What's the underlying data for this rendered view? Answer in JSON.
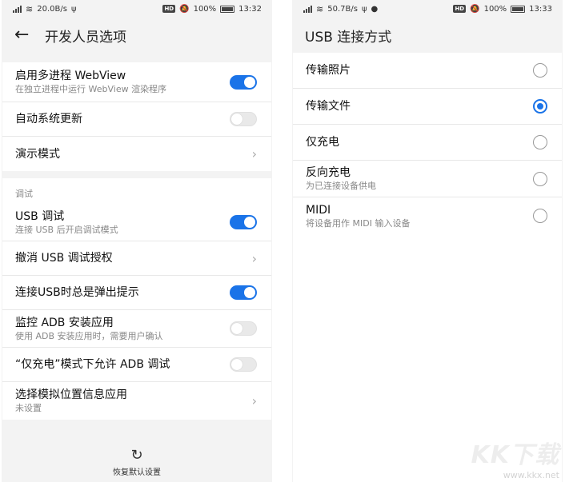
{
  "left": {
    "status": {
      "speed": "20.0B/s",
      "battery": "100%",
      "time": "13:32"
    },
    "title": "开发人员选项",
    "rows_top": [
      {
        "title": "启用多进程 WebView",
        "subtitle": "在独立进程中运行 WebView 渲染程序",
        "control": "toggle",
        "on": true
      },
      {
        "title": "自动系统更新",
        "subtitle": "",
        "control": "toggle",
        "on": false
      },
      {
        "title": "演示模式",
        "subtitle": "",
        "control": "chevron"
      }
    ],
    "section_label": "调试",
    "rows_debug": [
      {
        "title": "USB 调试",
        "subtitle": "连接 USB 后开启调试模式",
        "control": "toggle",
        "on": true
      },
      {
        "title": "撤消 USB 调试授权",
        "subtitle": "",
        "control": "chevron"
      },
      {
        "title": "连接USB时总是弹出提示",
        "subtitle": "",
        "control": "toggle",
        "on": true
      },
      {
        "title": "监控 ADB 安装应用",
        "subtitle": "使用 ADB 安装应用时，需要用户确认",
        "control": "toggle",
        "on": false
      },
      {
        "title": "“仅充电”模式下允许 ADB 调试",
        "subtitle": "",
        "control": "toggle",
        "on": false
      },
      {
        "title": "选择模拟位置信息应用",
        "subtitle": "未设置",
        "control": "chevron"
      }
    ],
    "reset_label": "恢复默认设置"
  },
  "right": {
    "status": {
      "speed": "50.7B/s",
      "battery": "100%",
      "time": "13:33"
    },
    "title": "USB 连接方式",
    "options": [
      {
        "title": "传输照片",
        "subtitle": "",
        "selected": false
      },
      {
        "title": "传输文件",
        "subtitle": "",
        "selected": true
      },
      {
        "title": "仅充电",
        "subtitle": "",
        "selected": false
      },
      {
        "title": "反向充电",
        "subtitle": "为已连接设备供电",
        "selected": false
      },
      {
        "title": "MIDI",
        "subtitle": "将设备用作 MIDI 输入设备",
        "selected": false
      }
    ]
  },
  "watermark": {
    "logo": "KK下载",
    "url": "www.kkx.net"
  },
  "colors": {
    "accent": "#1a73e8",
    "background": "#f3f3f3"
  }
}
